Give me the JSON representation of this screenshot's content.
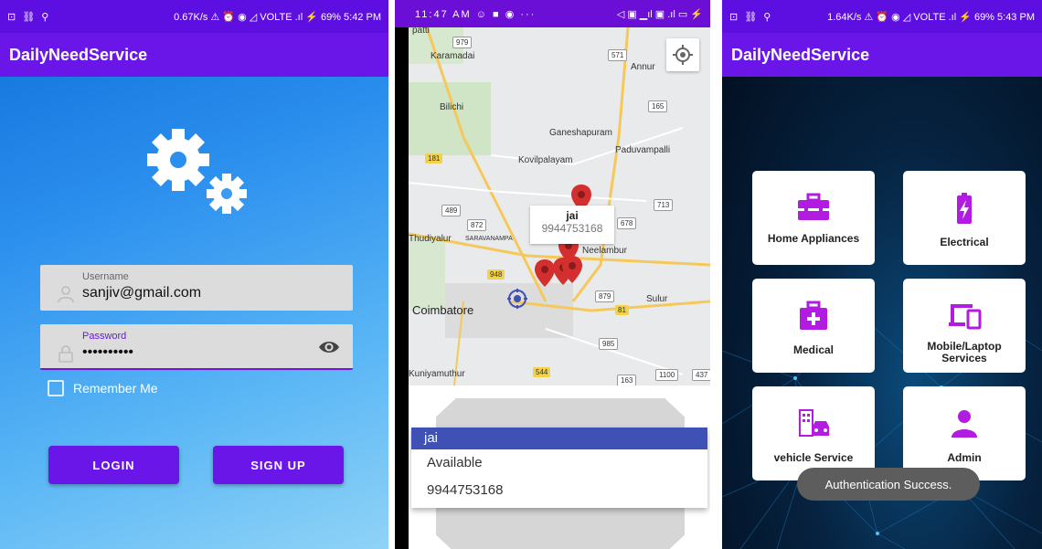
{
  "screen1": {
    "status": {
      "left": "⊡ ⛓ ⚲",
      "right": "0.67K/s ⚠ ⏰ ◉ ◿ VOLTE .ıl ⚡ 69% 5:42 PM"
    },
    "app_title": "DailyNeedService",
    "username": {
      "label": "Username",
      "value": "sanjiv@gmail.com"
    },
    "password": {
      "label": "Password",
      "value": "••••••••••"
    },
    "remember_label": "Remember Me",
    "login_label": "LOGIN",
    "signup_label": "SIGN UP",
    "accent_color": "#6a16e8"
  },
  "screen2": {
    "status": {
      "left": "11:47 AM ☺ ■ ◉ ···",
      "right": "◁ ▣ ▁ıl ▣ .ıl ▭ ⚡"
    },
    "map": {
      "labels": [
        {
          "text": "patti",
          "big": false
        },
        {
          "text": "Karamadai",
          "big": false
        },
        {
          "text": "Annur",
          "big": false
        },
        {
          "text": "Bilichi",
          "big": false
        },
        {
          "text": "Ganeshapuram",
          "big": false
        },
        {
          "text": "Paduvampalli",
          "big": false
        },
        {
          "text": "Kovilpalayam",
          "big": false
        },
        {
          "text": "Thudiyalur",
          "big": false
        },
        {
          "text": "SARAVANAMPA",
          "big": false
        },
        {
          "text": "Neelambur",
          "big": false
        },
        {
          "text": "Coimbatore",
          "big": true
        },
        {
          "text": "Sulur",
          "big": false
        },
        {
          "text": "Kuniyamuthur",
          "big": false
        }
      ],
      "shields": [
        {
          "text": "979",
          "white": true
        },
        {
          "text": "571",
          "white": true
        },
        {
          "text": "165",
          "white": true
        },
        {
          "text": "181",
          "white": false
        },
        {
          "text": "489",
          "white": true
        },
        {
          "text": "872",
          "white": true
        },
        {
          "text": "713",
          "white": true
        },
        {
          "text": "678",
          "white": true
        },
        {
          "text": "948",
          "white": false
        },
        {
          "text": "879",
          "white": true
        },
        {
          "text": "81",
          "white": false
        },
        {
          "text": "985",
          "white": true
        },
        {
          "text": "544",
          "white": false
        },
        {
          "text": "163",
          "white": true
        },
        {
          "text": "1100",
          "white": true
        },
        {
          "text": "437",
          "white": true
        }
      ],
      "info_title": "jai",
      "info_phone": "9944753168"
    },
    "popup": {
      "selected": "jai",
      "rows": [
        "Available",
        "9944753168"
      ]
    }
  },
  "screen3": {
    "status": {
      "left": "⊡ ⛓ ⚲",
      "right": "1.64K/s ⚠ ⏰ ◉ ◿ VOLTE .ıl ⚡ 69% 5:43 PM"
    },
    "app_title": "DailyNeedService",
    "cards": [
      {
        "label": "Home Appliances",
        "icon": "toolbox-icon"
      },
      {
        "label": "Electrical",
        "icon": "battery-icon"
      },
      {
        "label": "Medical",
        "icon": "medical-kit-icon"
      },
      {
        "label": "Mobile/Laptop Services",
        "icon": "devices-icon"
      },
      {
        "label": "vehicle Service",
        "icon": "car-building-icon"
      },
      {
        "label": "Admin",
        "icon": "person-icon"
      }
    ],
    "toast": "Authentication Success.",
    "icon_color": "#b21be0"
  }
}
